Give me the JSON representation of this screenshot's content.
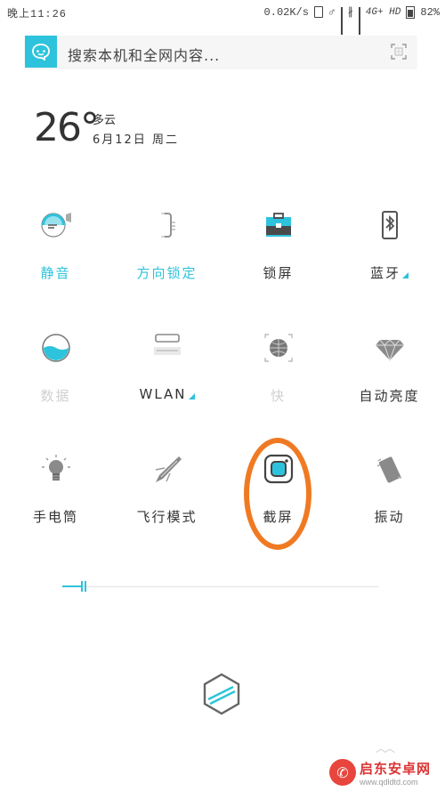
{
  "status_bar": {
    "time": "晚上11:26",
    "network_speed": "0.02K/s",
    "network_type": "4G+ HD",
    "battery": "82%"
  },
  "search": {
    "placeholder": "搜索本机和全网内容..."
  },
  "weather": {
    "temperature": "26°",
    "condition": "多云",
    "date": "6月12日 周二"
  },
  "quick_settings": {
    "row1": [
      {
        "label": "静音",
        "state": "active",
        "icon": "mute-icon"
      },
      {
        "label": "方向锁定",
        "state": "active",
        "icon": "rotation-lock-icon"
      },
      {
        "label": "锁屏",
        "state": "normal",
        "icon": "lock-screen-icon"
      },
      {
        "label": "蓝牙",
        "state": "normal",
        "icon": "bluetooth-icon",
        "has_menu": true
      }
    ],
    "row2": [
      {
        "label": "数据",
        "state": "faded",
        "icon": "mobile-data-icon"
      },
      {
        "label": "WLAN",
        "state": "normal",
        "icon": "wlan-icon",
        "has_menu": true
      },
      {
        "label": "快",
        "state": "faded",
        "icon": "hotspot-icon"
      },
      {
        "label": "自动亮度",
        "state": "normal",
        "icon": "auto-brightness-icon"
      }
    ],
    "row3": [
      {
        "label": "手电筒",
        "state": "normal",
        "icon": "flashlight-icon"
      },
      {
        "label": "飞行模式",
        "state": "normal",
        "icon": "airplane-mode-icon"
      },
      {
        "label": "截屏",
        "state": "normal",
        "icon": "screenshot-icon",
        "highlighted": true
      },
      {
        "label": "振动",
        "state": "normal",
        "icon": "vibrate-icon"
      }
    ]
  },
  "brightness": {
    "level": 0.06
  },
  "colors": {
    "accent": "#2ec3dc",
    "highlight": "#f07a23",
    "icon_gray": "#9a9a9a"
  },
  "watermark": {
    "name": "启东安卓网",
    "url": "www.qdldtd.com"
  }
}
